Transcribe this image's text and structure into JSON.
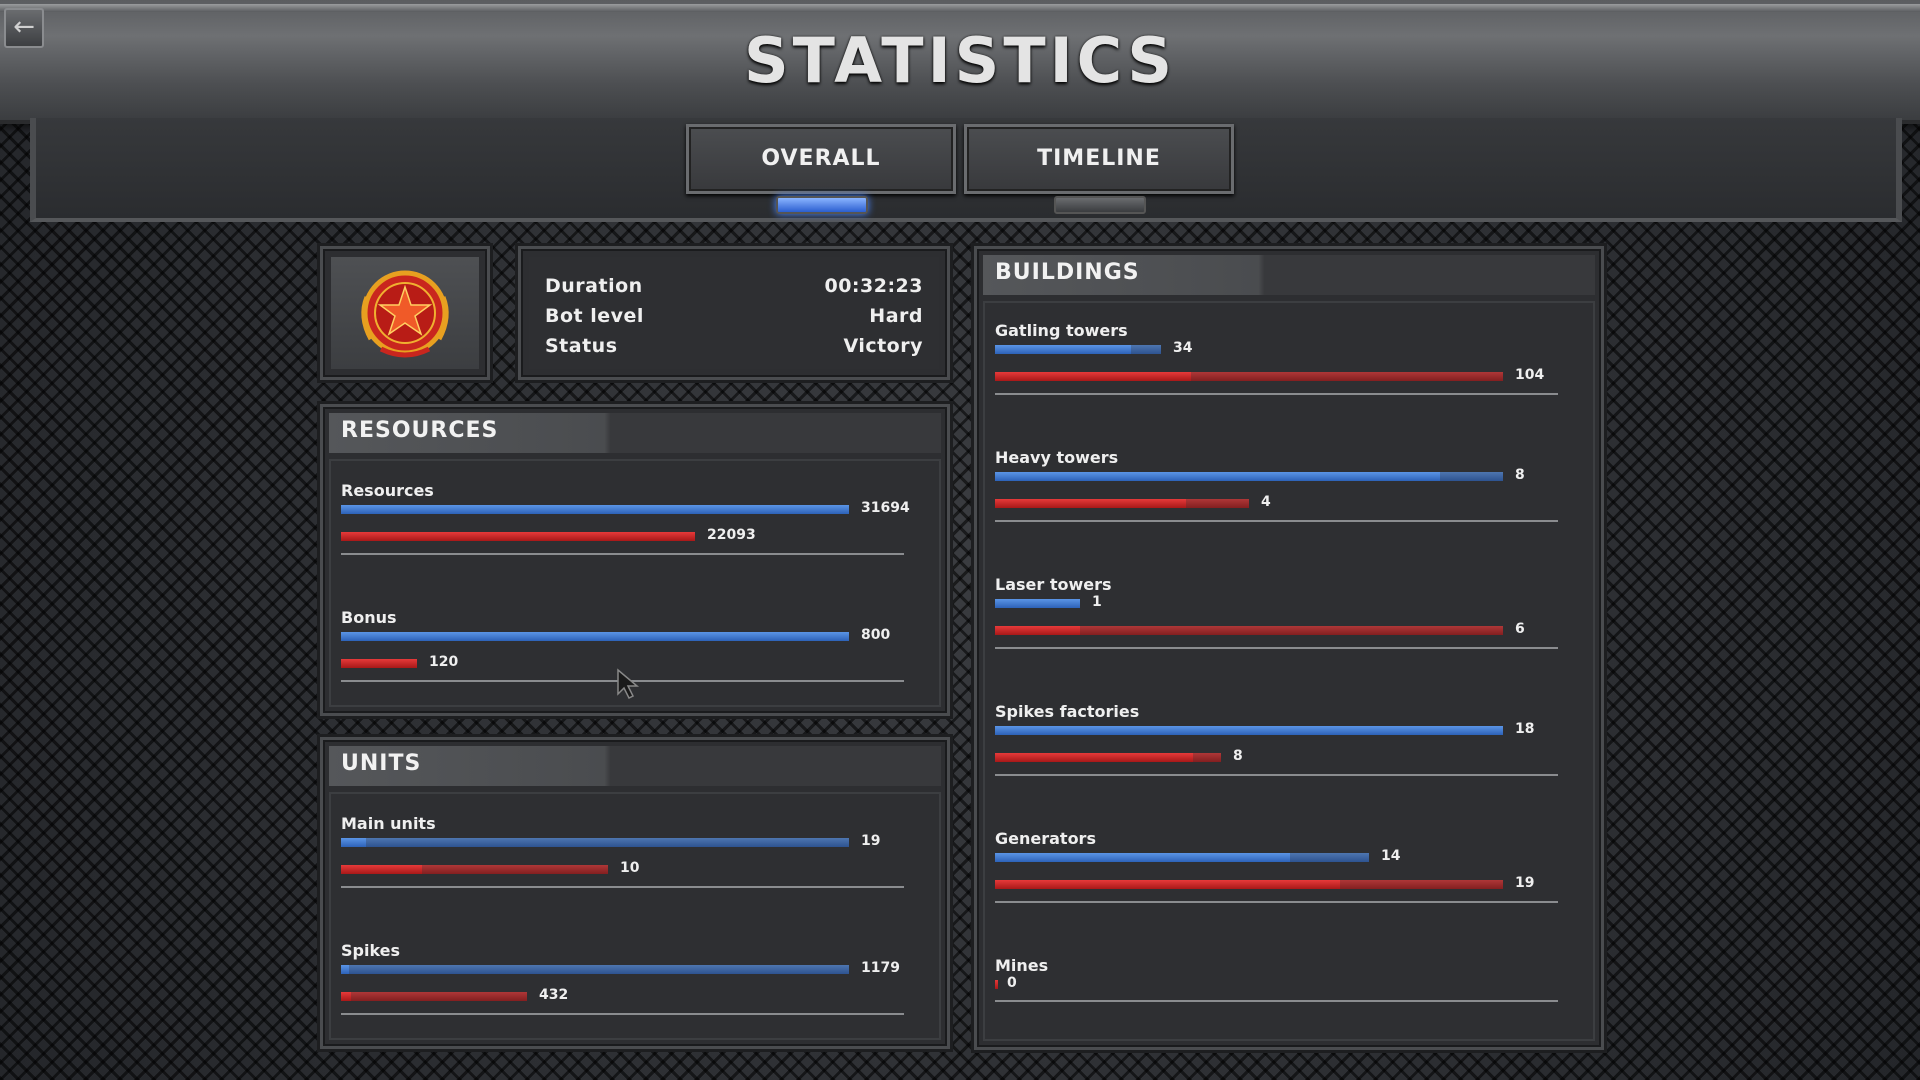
{
  "header": {
    "title": "STATISTICS",
    "back_icon": "back-arrow-icon"
  },
  "tabs": [
    {
      "label": "OVERALL",
      "active": true
    },
    {
      "label": "TIMELINE",
      "active": false
    }
  ],
  "emblem": {
    "icon": "red-star-wreath-emblem"
  },
  "match_info": {
    "rows": [
      {
        "key": "Duration",
        "value": "00:32:23"
      },
      {
        "key": "Bot level",
        "value": "Hard"
      },
      {
        "key": "Status",
        "value": "Victory"
      }
    ]
  },
  "resources": {
    "title": "RESOURCES",
    "items": [
      {
        "label": "Resources",
        "blue": "31694",
        "red": "22093",
        "blue_fill": 1.0,
        "red_fill": 0.697
      },
      {
        "label": "Bonus",
        "blue": "800",
        "red": "120",
        "blue_fill": 1.0,
        "red_fill": 0.15
      }
    ]
  },
  "units": {
    "title": "UNITS",
    "items": [
      {
        "label": "Main units",
        "blue": "19",
        "red": "10",
        "blue_fill": 0.05,
        "blue_track": 1.0,
        "red_fill": 0.16,
        "red_track": 0.526
      },
      {
        "label": "Spikes",
        "blue": "1179",
        "red": "432",
        "blue_fill": 0.015,
        "blue_track": 1.0,
        "red_fill": 0.02,
        "red_track": 0.366
      }
    ]
  },
  "buildings": {
    "title": "BUILDINGS",
    "items": [
      {
        "label": "Gatling towers",
        "blue": "34",
        "red": "104",
        "blue_fill": 0.268,
        "blue_track": 0.327,
        "red_fill": 0.385,
        "red_track": 1.0
      },
      {
        "label": "Heavy towers",
        "blue": "8",
        "red": "4",
        "blue_fill": 0.875,
        "blue_track": 1.0,
        "red_fill": 0.375,
        "red_track": 0.5
      },
      {
        "label": "Laser towers",
        "blue": "1",
        "red": "6",
        "blue_fill": 0.167,
        "blue_track": 0.167,
        "red_fill": 0.167,
        "red_track": 1.0
      },
      {
        "label": "Spikes factories",
        "blue": "18",
        "red": "8",
        "blue_fill": 1.0,
        "blue_track": 1.0,
        "red_fill": 0.389,
        "red_track": 0.444
      },
      {
        "label": "Generators",
        "blue": "14",
        "red": "19",
        "blue_fill": 0.58,
        "blue_track": 0.737,
        "red_fill": 0.68,
        "red_track": 1.0
      },
      {
        "label": "Mines",
        "blue": "0",
        "red": "",
        "blue_fill": 0.0,
        "blue_track": 0.0,
        "red_fill": 0.0,
        "red_track": 0.0
      }
    ]
  },
  "colors": {
    "player": "#3a78d8",
    "enemy": "#d42424",
    "accent": "#4a86ff"
  }
}
